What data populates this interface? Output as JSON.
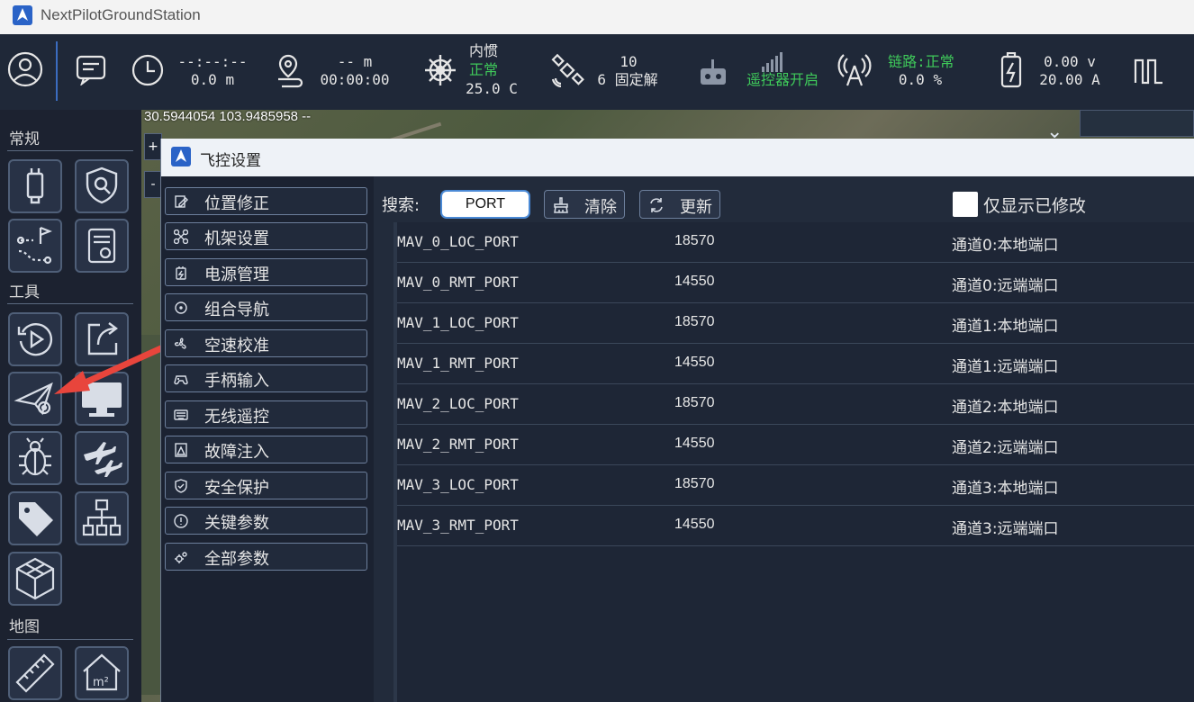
{
  "window": {
    "title": "NextPilotGroundStation"
  },
  "status": {
    "time_top": "--:--:--",
    "time_bottom": "0.0 m",
    "dist_top": "-- m",
    "dist_bottom": "00:00:00",
    "ins_title": "内惯",
    "ins_state": "正常",
    "ins_temp": "25.0 C",
    "gps_count": "10",
    "gps_fix": "6 固定解",
    "rc_state": "遥控器开启",
    "link_state": "链路:正常",
    "link_loss": "0.0 %",
    "battery_v": "0.00 v",
    "battery_a": "20.00 A"
  },
  "map": {
    "coords": "30.5944054 103.9485958 --",
    "zoom_in": "+",
    "zoom_out": "-"
  },
  "sidebar": {
    "section_general": "常规",
    "section_tools": "工具",
    "section_map": "地图"
  },
  "dialog": {
    "title": "飞控设置",
    "nav": [
      {
        "label": "位置修正"
      },
      {
        "label": "机架设置"
      },
      {
        "label": "电源管理"
      },
      {
        "label": "组合导航"
      },
      {
        "label": "空速校准"
      },
      {
        "label": "手柄输入"
      },
      {
        "label": "无线遥控"
      },
      {
        "label": "故障注入"
      },
      {
        "label": "安全保护"
      },
      {
        "label": "关键参数"
      },
      {
        "label": "全部参数"
      }
    ],
    "search_label": "搜索:",
    "search_value": "PORT",
    "clear_label": "清除",
    "refresh_label": "更新",
    "modified_only_label": "仅显示已修改",
    "rows": [
      {
        "name": "MAV_0_LOC_PORT",
        "value": "18570",
        "desc": "通道0:本地端口"
      },
      {
        "name": "MAV_0_RMT_PORT",
        "value": "14550",
        "desc": "通道0:远端端口"
      },
      {
        "name": "MAV_1_LOC_PORT",
        "value": "18570",
        "desc": "通道1:本地端口"
      },
      {
        "name": "MAV_1_RMT_PORT",
        "value": "14550",
        "desc": "通道1:远端端口"
      },
      {
        "name": "MAV_2_LOC_PORT",
        "value": "18570",
        "desc": "通道2:本地端口"
      },
      {
        "name": "MAV_2_RMT_PORT",
        "value": "14550",
        "desc": "通道2:远端端口"
      },
      {
        "name": "MAV_3_LOC_PORT",
        "value": "18570",
        "desc": "通道3:本地端口"
      },
      {
        "name": "MAV_3_RMT_PORT",
        "value": "14550",
        "desc": "通道3:远端端口"
      }
    ]
  },
  "colors": {
    "accent_green": "#3fca5a",
    "arrow_red": "#e8453c"
  }
}
